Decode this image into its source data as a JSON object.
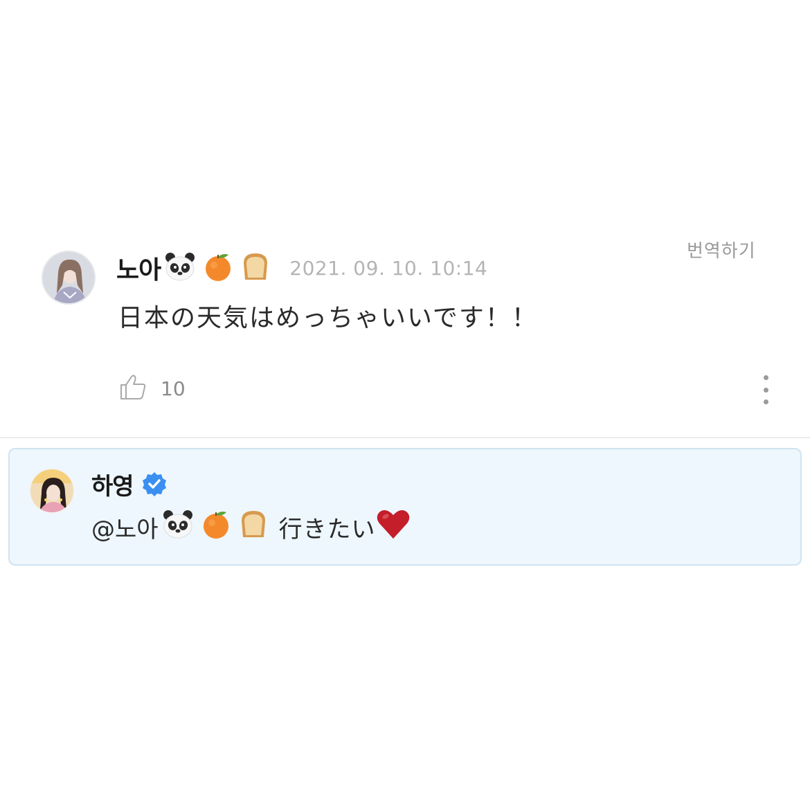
{
  "comment": {
    "author": "노아",
    "emojis": [
      "🐼",
      "🍊",
      "🍞"
    ],
    "timestamp": "2021. 09. 10. 10:14",
    "translate_label": "번역하기",
    "text": "日本の天気はめっちゃいいです！！",
    "likes": "10"
  },
  "reply": {
    "author": "하영",
    "verified": true,
    "mention": "@노아",
    "mention_emojis": [
      "🐼",
      "🍊",
      "🍞"
    ],
    "text": "行きたい",
    "trailing_emoji": "❤️"
  },
  "colors": {
    "reply_background": "#eef7fd",
    "reply_border": "#cfe3f1",
    "verified_badge": "#3b8ff0",
    "timestamp": "#b4b4b4"
  }
}
